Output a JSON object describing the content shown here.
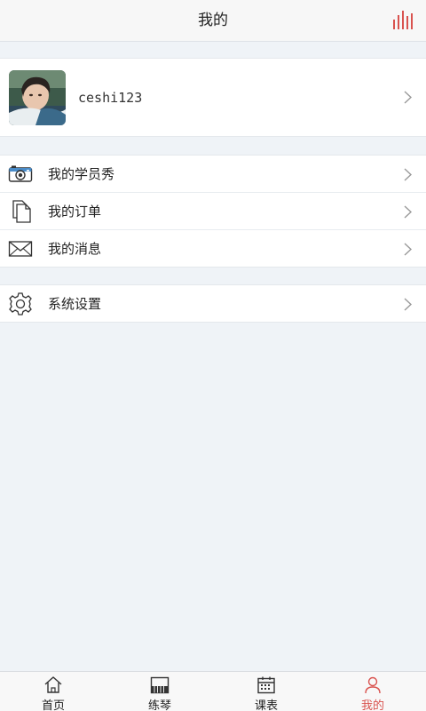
{
  "header": {
    "title": "我的",
    "action_icon": "bar-chart-icon",
    "accent_color": "#d9534f"
  },
  "profile": {
    "username": "ceshi123",
    "avatar_icon": "user-photo"
  },
  "menu": {
    "groups": [
      {
        "items": [
          {
            "label": "我的学员秀",
            "icon": "camera-icon"
          },
          {
            "label": "我的订单",
            "icon": "document-icon"
          },
          {
            "label": "我的消息",
            "icon": "envelope-icon"
          }
        ]
      },
      {
        "items": [
          {
            "label": "系统设置",
            "icon": "gear-icon"
          }
        ]
      }
    ]
  },
  "tabbar": {
    "items": [
      {
        "label": "首页",
        "icon": "home-icon",
        "active": false
      },
      {
        "label": "练琴",
        "icon": "piano-icon",
        "active": false
      },
      {
        "label": "课表",
        "icon": "calendar-icon",
        "active": false
      },
      {
        "label": "我的",
        "icon": "person-icon",
        "active": true
      }
    ],
    "active_color": "#d9534f"
  }
}
